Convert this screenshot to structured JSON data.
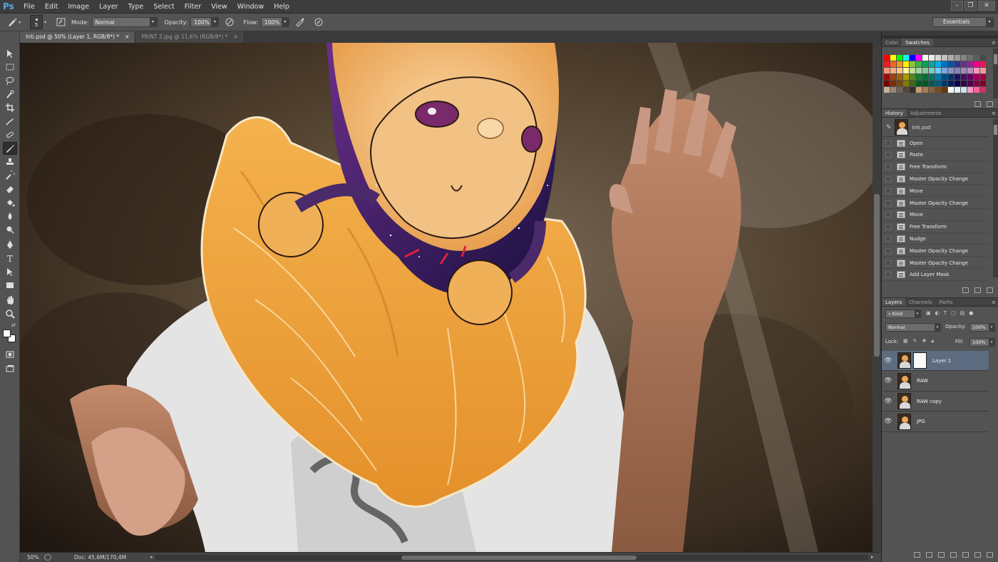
{
  "app": {
    "logo": "Ps"
  },
  "menu": [
    "File",
    "Edit",
    "Image",
    "Layer",
    "Type",
    "Select",
    "Filter",
    "View",
    "Window",
    "Help"
  ],
  "window_controls": [
    "minimize-icon",
    "restore-icon",
    "close-icon"
  ],
  "options_bar": {
    "brush_size": "5",
    "mode_label": "Mode:",
    "mode_value": "Normal",
    "opacity_label": "Opacity:",
    "opacity_value": "100%",
    "flow_label": "Flow:",
    "flow_value": "100%",
    "workspace": "Essentials"
  },
  "document_tabs": [
    {
      "label": "Inti.psd @ 50% (Layer 1, RGB/8*) *",
      "active": true
    },
    {
      "label": "PRINT 2.jpg @ 11,6% (RGB/8*) *",
      "active": false
    }
  ],
  "status_bar": {
    "zoom": "50%",
    "doc": "Doc: 45,6M/170,4M"
  },
  "panels": {
    "color_tabs": [
      "Color",
      "Swatches"
    ],
    "history_tabs": [
      "History",
      "Adjustments"
    ],
    "history_snapshot": "Inti.psd",
    "history_items": [
      "Open",
      "Paste",
      "Free Transform",
      "Master Opacity Change",
      "Move",
      "Master Opacity Change",
      "Move",
      "Free Transform",
      "Nudge",
      "Master Opacity Change",
      "Master Opacity Change",
      "Add Layer Mask"
    ],
    "layers_tabs": [
      "Layers",
      "Channels",
      "Paths"
    ],
    "kind_label": "Kind",
    "blend_mode": "Normal",
    "opacity_label": "Opacity:",
    "opacity_value": "100%",
    "lock_label": "Lock:",
    "fill_label": "Fill:",
    "fill_value": "100%",
    "layers": [
      {
        "name": "Layer 1",
        "selected": true,
        "has_mask": true
      },
      {
        "name": "RAW",
        "selected": false,
        "has_mask": false
      },
      {
        "name": "RAW copy",
        "selected": false,
        "has_mask": false
      },
      {
        "name": "JPG",
        "selected": false,
        "has_mask": false
      }
    ]
  },
  "colors": {
    "swatches": [
      "#ff0000",
      "#ffff00",
      "#00ff00",
      "#00ffff",
      "#0000ff",
      "#ff00ff",
      "#ffffff",
      "#ebebeb",
      "#d6d6d6",
      "#c2c2c2",
      "#adadad",
      "#999999",
      "#858585",
      "#707070",
      "#5c5c5c",
      "#474747",
      "#ed1c24",
      "#f26522",
      "#f7941d",
      "#fff200",
      "#8dc63f",
      "#39b54a",
      "#00a651",
      "#00a99d",
      "#00aeef",
      "#0072bc",
      "#0054a6",
      "#2e3192",
      "#662d91",
      "#92278f",
      "#ec008c",
      "#ed145b",
      "#f69679",
      "#f9ad81",
      "#fdc68a",
      "#fff79a",
      "#c4df9b",
      "#a3d39c",
      "#82ca9d",
      "#7accc8",
      "#6dcff6",
      "#7da7d9",
      "#8393ca",
      "#8781bd",
      "#a186be",
      "#bd8cbf",
      "#f49ac1",
      "#f5989d",
      "#9e0b0f",
      "#a0410d",
      "#a3620a",
      "#aba000",
      "#598527",
      "#197b30",
      "#007236",
      "#00746b",
      "#0076a3",
      "#004a80",
      "#003471",
      "#1b1464",
      "#440e62",
      "#630460",
      "#9e005d",
      "#9e0039",
      "#790000",
      "#7b2e00",
      "#7d4900",
      "#827b00",
      "#406618",
      "#005e20",
      "#005826",
      "#005952",
      "#005b7f",
      "#003663",
      "#002157",
      "#0d004c",
      "#32004b",
      "#4b0049",
      "#7b0046",
      "#7a0026",
      "#c7b299",
      "#998675",
      "#736357",
      "#534741",
      "#37302d",
      "#c69c6d",
      "#a67c52",
      "#8c6239",
      "#754c24",
      "#603913",
      "#ffffff",
      "#e1f0f0",
      "#c8e6f0",
      "#ff99cc",
      "#ff6699",
      "#cc3366"
    ]
  }
}
